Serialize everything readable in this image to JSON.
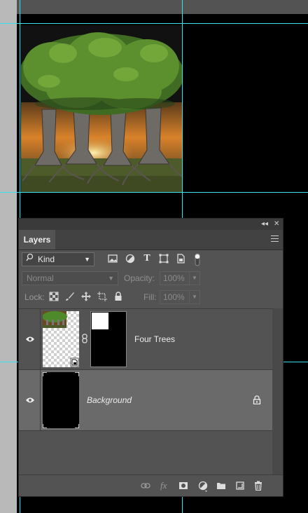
{
  "panel": {
    "tab_label": "Layers",
    "collapse_glyph": "◂◂",
    "close_glyph": "✕"
  },
  "filter": {
    "kind_label": "Kind",
    "icons": [
      "image-filter-icon",
      "adjustment-filter-icon",
      "type-filter-icon",
      "shape-filter-icon",
      "smart-object-filter-icon",
      "filter-toggle-icon"
    ],
    "type_glyph": "T"
  },
  "blend": {
    "mode": "Normal",
    "opacity_label": "Opacity:",
    "opacity_value": "100%"
  },
  "lock": {
    "label": "Lock:",
    "fill_label": "Fill:",
    "fill_value": "100%"
  },
  "layers": [
    {
      "name": "Four Trees",
      "visible": true,
      "selected": false,
      "has_mask": true,
      "linked": true
    },
    {
      "name": "Background",
      "visible": true,
      "selected": true,
      "locked": true
    }
  ],
  "bottom_bar": {
    "fx_label": "fx",
    "icons": [
      "link-layers-icon",
      "fx-icon",
      "add-mask-icon",
      "adjustment-layer-icon",
      "new-group-icon",
      "new-layer-icon",
      "delete-layer-icon"
    ]
  },
  "colors": {
    "guide": "#35e0ef",
    "panel_bg": "#535353",
    "selected_row": "#6a6a6a"
  }
}
